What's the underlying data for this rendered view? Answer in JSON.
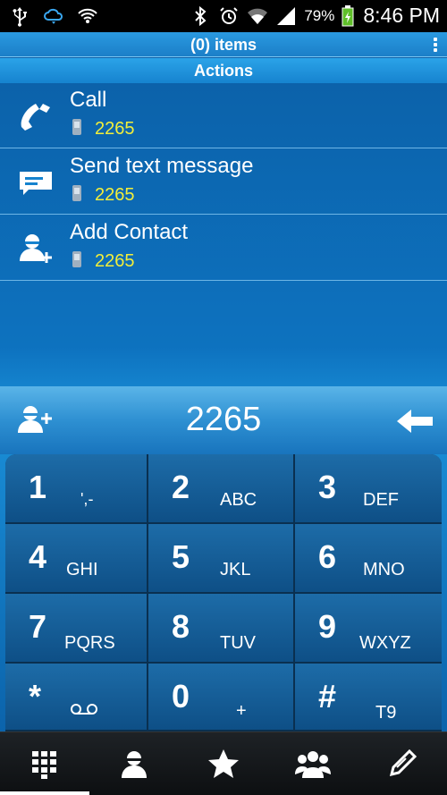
{
  "status_bar": {
    "battery_percent": "79%",
    "time": "8:46 PM",
    "icons": [
      "usb-icon",
      "cloud-sync-icon",
      "wifi-hotspot-icon",
      "bluetooth-icon",
      "alarm-icon",
      "wifi-icon",
      "signal-icon",
      "battery-icon"
    ]
  },
  "header": {
    "items_label": "(0) items",
    "actions_label": "Actions",
    "menu_icon": "overflow-menu-icon"
  },
  "actions": [
    {
      "title": "Call",
      "number": "2265",
      "icon": "phone-handset-icon"
    },
    {
      "title": "Send text message",
      "number": "2265",
      "icon": "message-icon"
    },
    {
      "title": "Add Contact",
      "number": "2265",
      "icon": "add-contact-icon"
    }
  ],
  "entry": {
    "digits": "2265",
    "add_icon": "add-contact-icon",
    "backspace_icon": "backspace-arrow-icon"
  },
  "keypad": [
    {
      "digit": "1",
      "letters": "',-"
    },
    {
      "digit": "2",
      "letters": "ABC"
    },
    {
      "digit": "3",
      "letters": "DEF"
    },
    {
      "digit": "4",
      "letters": "GHI"
    },
    {
      "digit": "5",
      "letters": "JKL"
    },
    {
      "digit": "6",
      "letters": "MNO"
    },
    {
      "digit": "7",
      "letters": "PQRS"
    },
    {
      "digit": "8",
      "letters": "TUV"
    },
    {
      "digit": "9",
      "letters": "WXYZ"
    },
    {
      "digit": "*",
      "letters": ""
    },
    {
      "digit": "0",
      "letters": "+"
    },
    {
      "digit": "#",
      "letters": "T9"
    }
  ],
  "bottom_nav": [
    "dialpad-icon",
    "contacts-icon",
    "favorites-star-icon",
    "groups-icon",
    "edit-pencil-icon"
  ],
  "colors": {
    "number_highlight": "#f2ee3a",
    "accent_blue": "#1683cf"
  }
}
